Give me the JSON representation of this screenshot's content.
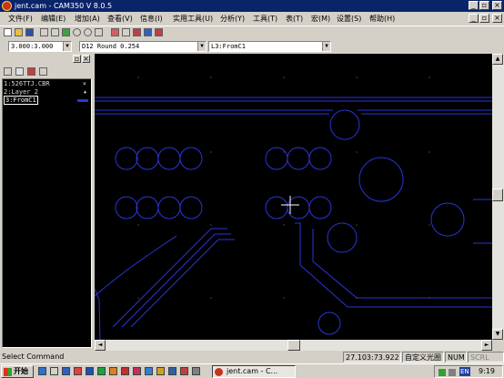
{
  "window": {
    "title": "jent.cam - CAM350 V 8.0.5",
    "minimize": "_",
    "restore": "▫",
    "close": "×"
  },
  "menu": {
    "items": [
      "文件(F)",
      "编辑(E)",
      "增加(A)",
      "查看(V)",
      "信息(I)",
      "实用工具(U)",
      "分析(Y)",
      "工具(T)",
      "表(T)",
      "宏(M)",
      "设置(S)",
      "帮助(H)"
    ]
  },
  "combos": {
    "grid": "3.000:3.000",
    "dcode": "D12    Round 0.254",
    "layer": "L3:FromC1"
  },
  "layers": [
    {
      "label": "1:526TTJ.CBR",
      "flag": "×",
      "color": "#d8d8d8"
    },
    {
      "label": "2:Layer 2",
      "flag": "▲",
      "color": "#d8d8d8"
    },
    {
      "label": "3:FromC1",
      "flag": "",
      "color": "#ffffff"
    }
  ],
  "statusbar": {
    "prompt": "Select Command",
    "coords": "27.103:73.922",
    "mode": "自定义光圈",
    "num": "NUM",
    "scrl": "SCRL"
  },
  "taskbar": {
    "start": "开始",
    "task": "jent.cam - C...",
    "lang": "EN",
    "time": "9:19"
  },
  "colors": {
    "titlebar": "#0a246a",
    "trace": "#2a35d8",
    "canvas_bg": "#000000"
  }
}
